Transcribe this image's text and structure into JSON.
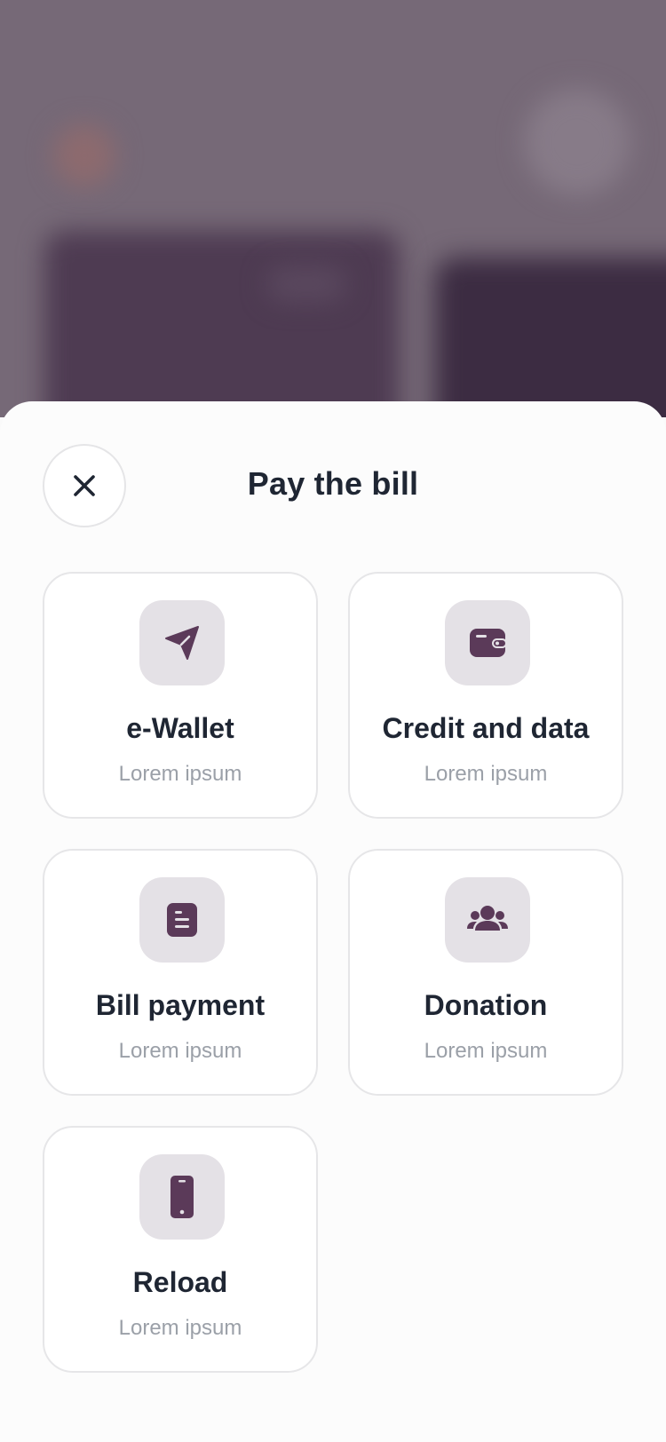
{
  "sheet": {
    "title": "Pay the bill"
  },
  "options": [
    {
      "title": "e-Wallet",
      "subtitle": "Lorem ipsum",
      "icon": "send-icon"
    },
    {
      "title": "Credit and data",
      "subtitle": "Lorem ipsum",
      "icon": "wallet-icon"
    },
    {
      "title": "Bill payment",
      "subtitle": "Lorem ipsum",
      "icon": "document-icon"
    },
    {
      "title": "Donation",
      "subtitle": "Lorem ipsum",
      "icon": "people-icon"
    },
    {
      "title": "Reload",
      "subtitle": "Lorem ipsum",
      "icon": "phone-icon"
    }
  ],
  "colors": {
    "accent": "#5b3a59",
    "title": "#1f2633",
    "subtitle": "#9ba0a8",
    "icon_bg": "#e4e1e6",
    "backdrop": "#766977"
  }
}
